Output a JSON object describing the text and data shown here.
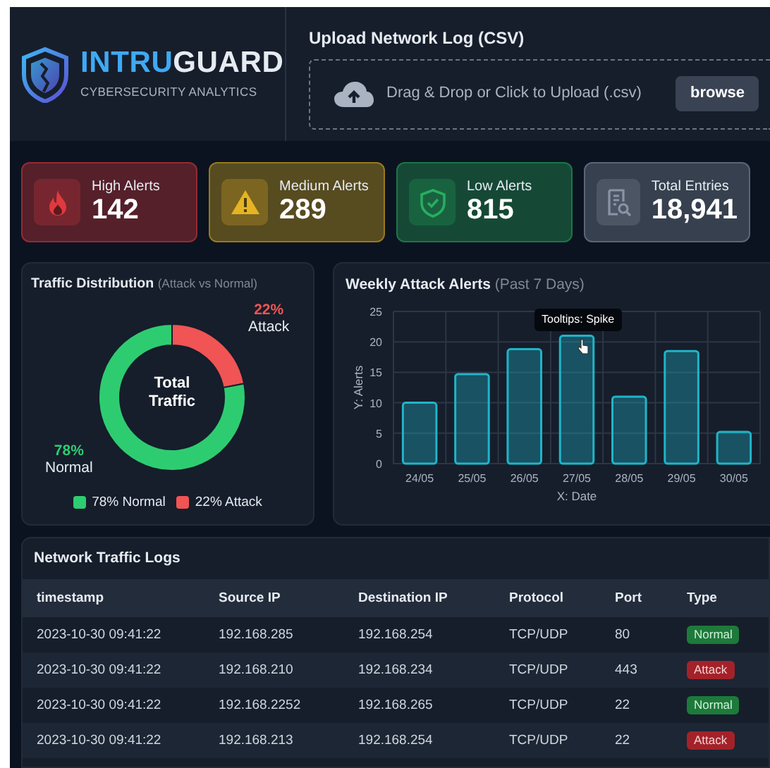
{
  "brand": {
    "name": [
      {
        "text": "INTRU",
        "accent": true
      },
      {
        "text": "GUARD",
        "accent": false
      }
    ],
    "tagline": "CYBERSECURITY ANALYTICS"
  },
  "upload": {
    "title": "Upload Network Log (CSV)",
    "hint": "Drag & Drop or Click to Upload (.csv)",
    "button": "browse"
  },
  "stats": [
    {
      "kind": "flame",
      "label": "High Alerts",
      "value": "142",
      "color": "#e0393e"
    },
    {
      "kind": "warning",
      "label": "Medium Alerts",
      "value": "289",
      "color": "#e6b422"
    },
    {
      "kind": "shield",
      "label": "Low Alerts",
      "value": "815",
      "color": "#27ae60"
    },
    {
      "kind": "document",
      "label": "Total Entries",
      "value": "18,941",
      "color": "#8a94a6"
    }
  ],
  "distribution": {
    "title": "Traffic Distribution",
    "subtitle": "(Attack vs Normal)",
    "center_label": "Total Traffic",
    "chart_data": {
      "type": "donut",
      "categories": [
        "Normal",
        "Attack"
      ],
      "values": [
        78,
        22
      ]
    },
    "slice_labels": [
      {
        "percent": "78%",
        "color": "#2ecc71"
      },
      {
        "percent": "22%",
        "color": "#f05454"
      }
    ],
    "legend": [
      {
        "label": "78% Normal",
        "color": "#2ecc71"
      },
      {
        "label": "22% Attack",
        "color": "#f05454"
      }
    ]
  },
  "weekly": {
    "title": "Weekly Attack Alerts",
    "subtitle": "(Past 7 Days)",
    "chart_data": {
      "type": "bar",
      "xlabel": "X: Date",
      "ylabel": "Y: Alerts",
      "categories": [
        "24/05",
        "25/05",
        "26/05",
        "27/05",
        "28/05",
        "29/05",
        "30/05"
      ],
      "values": [
        10,
        14.7,
        18.8,
        21,
        11,
        18.5,
        5.2
      ],
      "ylim": [
        0,
        25
      ],
      "yticks": [
        0,
        5,
        10,
        15,
        20,
        25
      ],
      "grid": true,
      "annotations": [
        "Tooltips: Spike"
      ]
    }
  },
  "logs": {
    "title": "Network Traffic Logs",
    "columns": [
      "timestamp",
      "Source IP",
      "Destination IP",
      "Protocol",
      "Port",
      "Type"
    ],
    "rows": [
      {
        "cells": [
          "2023-10-30 09:41:22",
          "192.168.285",
          "192.168.254",
          "TCP/UDP",
          "80"
        ],
        "type": {
          "label": "Normal",
          "kind": "normal"
        }
      },
      {
        "cells": [
          "2023-10-30 09:41:22",
          "192.168.210",
          "192.168.234",
          "TCP/UDP",
          "443"
        ],
        "type": {
          "label": "Attack",
          "kind": "attack"
        }
      },
      {
        "cells": [
          "2023-10-30 09:41:22",
          "192.168.2252",
          "192.168.265",
          "TCP/UDP",
          "22"
        ],
        "type": {
          "label": "Normal",
          "kind": "normal"
        }
      },
      {
        "cells": [
          "2023-10-30 09:41:22",
          "192.168.213",
          "192.168.254",
          "TCP/UDP",
          "22"
        ],
        "type": {
          "label": "Attack",
          "kind": "attack"
        }
      }
    ]
  }
}
